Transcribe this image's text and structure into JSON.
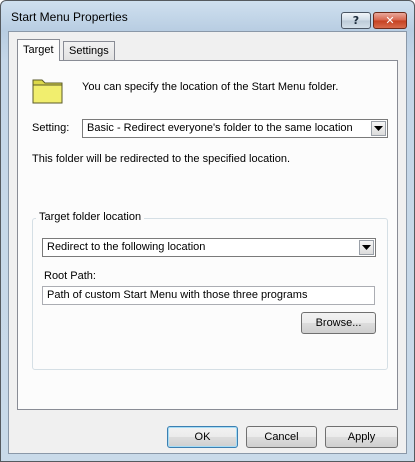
{
  "window": {
    "title": "Start Menu Properties",
    "help_label": "?",
    "close_label": "✕"
  },
  "tabs": [
    {
      "label": "Target",
      "selected": true
    },
    {
      "label": "Settings",
      "selected": false
    }
  ],
  "target": {
    "intro": "You can specify the location of the Start Menu folder.",
    "setting_label": "Setting:",
    "setting_value": "Basic - Redirect everyone's folder to the same location",
    "redirect_info": "This folder will be redirected to the specified location.",
    "group_title": "Target folder location",
    "target_location_value": "Redirect to the following location",
    "root_path_label": "Root Path:",
    "root_path_value": "Path of custom Start Menu with those three  programs",
    "browse_label": "Browse..."
  },
  "footer": {
    "ok_label": "OK",
    "cancel_label": "Cancel",
    "apply_label": "Apply"
  },
  "icons": {
    "folder": "folder-icon",
    "dropdown": "chevron-down-icon"
  },
  "colors": {
    "folder_fill": "#f1ee6e",
    "title_bar": "#c4d6e8",
    "close_button": "#c5401f"
  }
}
